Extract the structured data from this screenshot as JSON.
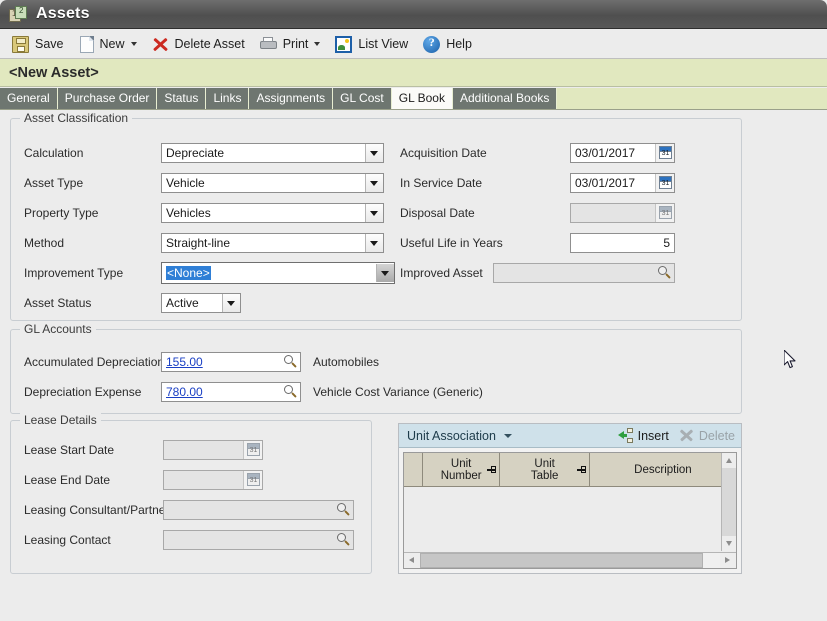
{
  "window": {
    "title": "Assets",
    "icon": "assets-window-icon"
  },
  "toolbar": {
    "items": [
      {
        "label": "Save",
        "icon": "save-icon",
        "dropdown": false
      },
      {
        "label": "New",
        "icon": "new-page-icon",
        "dropdown": true
      },
      {
        "label": "Delete Asset",
        "icon": "delete-x-icon",
        "dropdown": false
      },
      {
        "label": "Print",
        "icon": "printer-icon",
        "dropdown": true
      },
      {
        "label": "List View",
        "icon": "list-view-icon",
        "dropdown": false
      },
      {
        "label": "Help",
        "icon": "help-icon",
        "dropdown": false
      }
    ]
  },
  "record": {
    "title": "<New Asset>",
    "band_color": "#e1e8bf"
  },
  "tabs": {
    "items": [
      {
        "label": "General",
        "selected": false
      },
      {
        "label": "Purchase Order",
        "selected": false
      },
      {
        "label": "Status",
        "selected": false
      },
      {
        "label": "Links",
        "selected": false
      },
      {
        "label": "Assignments",
        "selected": false
      },
      {
        "label": "GL Cost",
        "selected": false
      },
      {
        "label": "GL Book",
        "selected": true
      },
      {
        "label": "Additional Books",
        "selected": false
      }
    ]
  },
  "asset_classification": {
    "legend": "Asset Classification",
    "left_fields": [
      {
        "label": "Calculation",
        "value": "Depreciate",
        "type": "combo",
        "focused": false
      },
      {
        "label": "Asset Type",
        "value": "Vehicle",
        "type": "combo",
        "focused": false
      },
      {
        "label": "Property Type",
        "value": "Vehicles",
        "type": "combo",
        "focused": false
      },
      {
        "label": "Method",
        "value": "Straight-line",
        "type": "combo",
        "focused": false
      },
      {
        "label": "Improvement Type",
        "value": "<None>",
        "type": "combo",
        "focused": true
      },
      {
        "label": "Asset Status",
        "value": "Active",
        "type": "combo-short",
        "focused": false
      }
    ],
    "right_fields": [
      {
        "label": "Acquisition Date",
        "value": "03/01/2017",
        "type": "date",
        "enabled": true
      },
      {
        "label": "In Service Date",
        "value": "03/01/2017",
        "type": "date",
        "enabled": true
      },
      {
        "label": "Disposal Date",
        "value": "",
        "type": "date",
        "enabled": false
      },
      {
        "label": "Useful Life in Years",
        "value": "5",
        "type": "number",
        "enabled": true
      },
      {
        "label": "Improved Asset",
        "value": "",
        "type": "lookup",
        "enabled": false
      }
    ]
  },
  "gl_accounts": {
    "legend": "GL Accounts",
    "rows": [
      {
        "label": "Accumulated Depreciation",
        "value": "155.00",
        "description": "Automobiles"
      },
      {
        "label": "Depreciation Expense",
        "value": "780.00",
        "description": "Vehicle Cost Variance (Generic)"
      }
    ]
  },
  "lease_details": {
    "legend": "Lease Details",
    "fields": [
      {
        "label": "Lease Start Date",
        "value": "",
        "type": "date",
        "enabled": false
      },
      {
        "label": "Lease End Date",
        "value": "",
        "type": "date",
        "enabled": false
      },
      {
        "label": "Leasing Consultant/Partner",
        "value": "",
        "type": "lookup",
        "enabled": false
      },
      {
        "label": "Leasing Contact",
        "value": "",
        "type": "lookup",
        "enabled": false
      }
    ]
  },
  "unit_association": {
    "title": "Unit Association",
    "insert_label": "Insert",
    "delete_label": "Delete",
    "delete_enabled": false,
    "columns": [
      {
        "label": "Unit\nNumber",
        "line1": "Unit",
        "line2": "Number"
      },
      {
        "label": "Unit Table",
        "line1": "Unit",
        "line2": "Table"
      },
      {
        "label": "Description",
        "line1": "Description",
        "line2": ""
      }
    ],
    "rows": []
  },
  "colors": {
    "titlebar": "#585858",
    "record_band": "#e1e8bf",
    "tab_unselected": "#6e7670",
    "tab_selected": "#fbfbf8",
    "panel_header": "#cfe1ea",
    "grid_header": "#d6d2c2",
    "link": "#1a3fc4",
    "selection": "#2f7fd6",
    "canvas": "#ececec"
  }
}
